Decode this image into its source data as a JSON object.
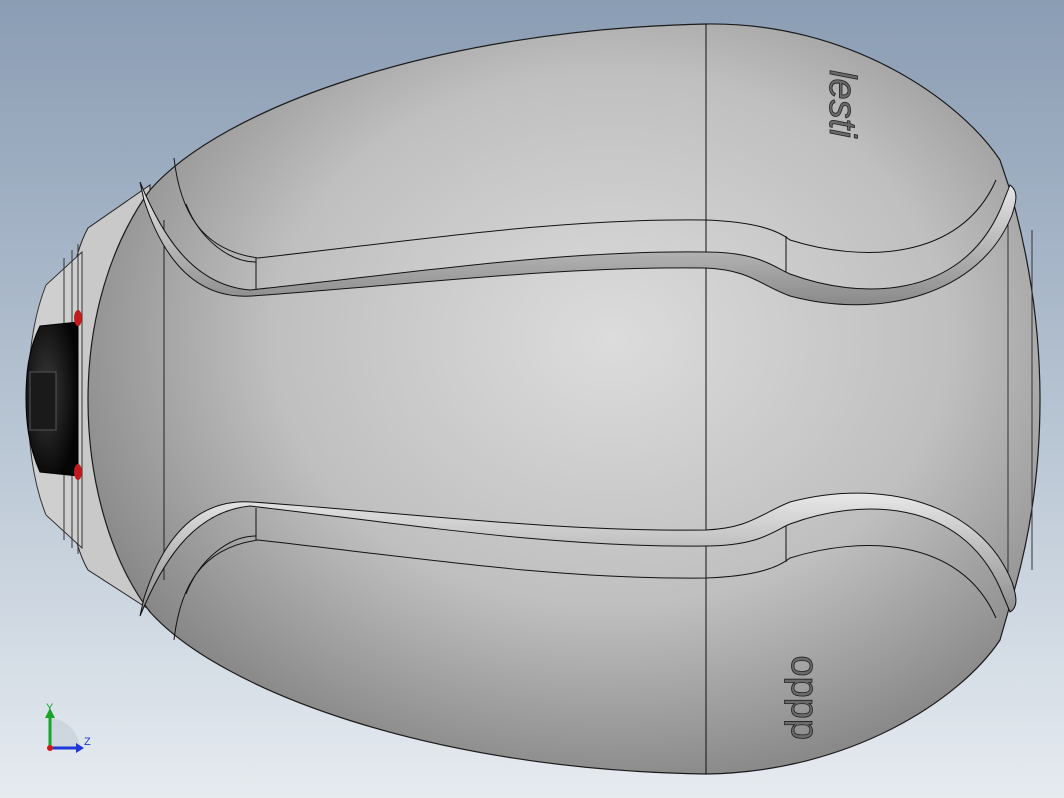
{
  "viewport": {
    "background_top": "#8b9db4",
    "background_bottom": "#e6ebf0"
  },
  "model": {
    "engraved_text_top": "lesti",
    "engraved_text_bottom": "dddo"
  },
  "triad": {
    "y_label": "Y",
    "z_label": "Z",
    "y_color": "#1aa32a",
    "z_color": "#1f36d8",
    "x_color": "#d01818"
  }
}
